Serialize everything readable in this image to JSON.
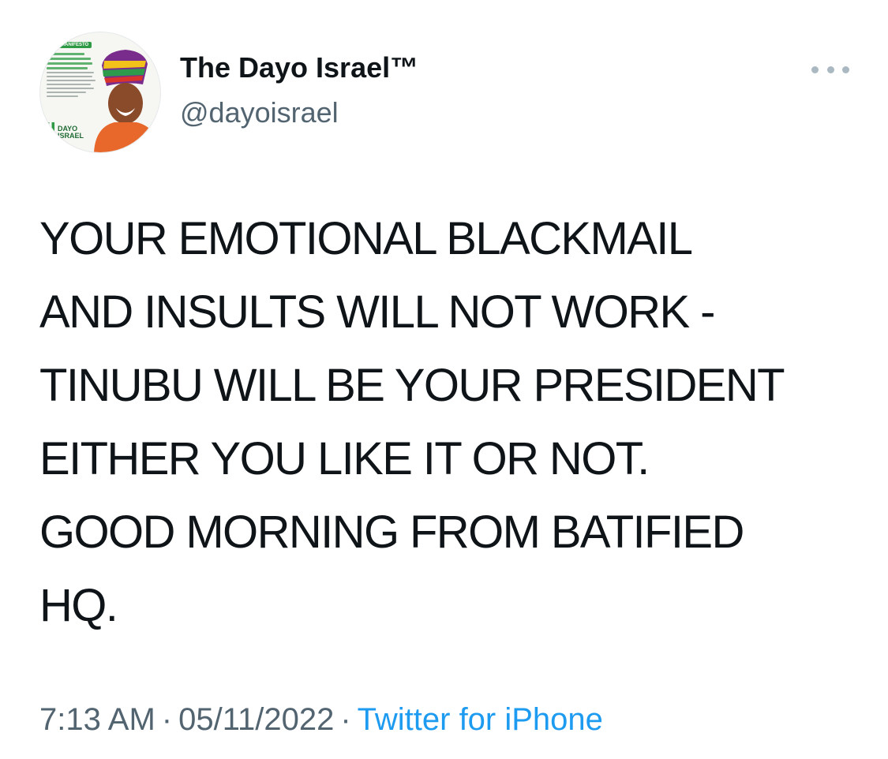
{
  "author": {
    "display_name": "The Dayo Israel™",
    "handle": "@dayoisrael",
    "avatar_text": {
      "tag": "MANIFESTO",
      "brand_line1": "DAYO",
      "brand_line2": "ISRAEL"
    }
  },
  "tweet": {
    "text": "YOUR EMOTIONAL BLACKMAIL\nAND INSULTS WILL NOT WORK -\nTINUBU WILL BE YOUR PRESIDENT\nEITHER YOU LIKE IT OR NOT.\nGOOD MORNING FROM BATIFIED\nHQ.",
    "time": "7:13 AM",
    "date": "05/11/2022",
    "separator": "·",
    "source": "Twitter for iPhone"
  },
  "icons": {
    "more": "more-horizontal-icon"
  },
  "colors": {
    "text": "#0f1419",
    "secondary": "#536471",
    "link": "#1d9bf0",
    "more_icon": "#aab8c2",
    "avatar_green": "#2f9a45"
  }
}
